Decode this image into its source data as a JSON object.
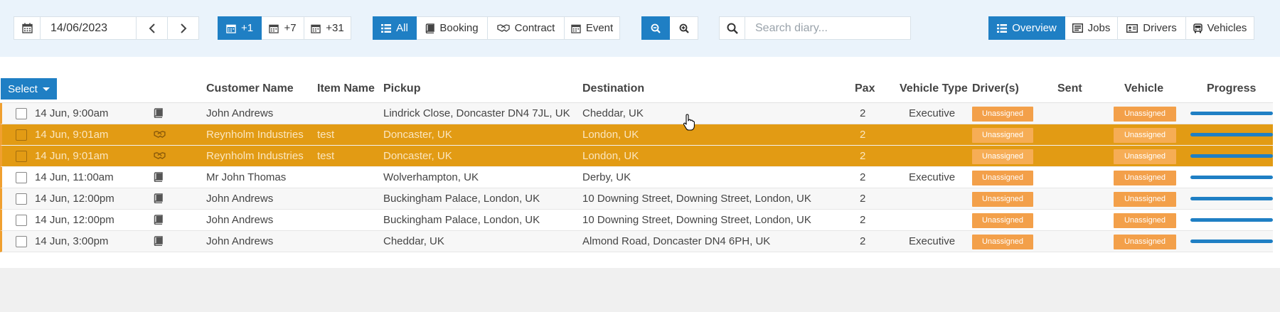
{
  "toolbar": {
    "date_value": "14/06/2023",
    "range_buttons": [
      "+1",
      "+7",
      "+31"
    ],
    "filter_buttons": [
      "All",
      "Booking",
      "Contract",
      "Event"
    ],
    "search_placeholder": "Search diary...",
    "view_buttons": [
      "Overview",
      "Jobs",
      "Drivers",
      "Vehicles"
    ]
  },
  "select_label": "Select",
  "columns": {
    "customer": "Customer Name",
    "item": "Item Name",
    "pickup": "Pickup",
    "destination": "Destination",
    "pax": "Pax",
    "vehicle_type": "Vehicle Type",
    "drivers": "Driver(s)",
    "sent": "Sent",
    "vehicle": "Vehicle",
    "progress": "Progress"
  },
  "rows": [
    {
      "time": "14 Jun, 9:00am",
      "type_icon": "book-icon",
      "customer": "John Andrews",
      "item": "",
      "pickup": "Lindrick Close, Doncaster DN4 7JL, UK",
      "destination": "Cheddar, UK",
      "pax": "2",
      "vehicle_type": "Executive",
      "driver": "Unassigned",
      "vehicle": "Unassigned",
      "highlight": false,
      "progress": 1
    },
    {
      "time": "14 Jun, 9:01am",
      "type_icon": "handshake-icon",
      "customer": "Reynholm Industries",
      "item": "test",
      "pickup": "Doncaster, UK",
      "destination": "London, UK",
      "pax": "2",
      "vehicle_type": "",
      "driver": "Unassigned",
      "vehicle": "Unassigned",
      "highlight": true,
      "progress": 1
    },
    {
      "time": "14 Jun, 9:01am",
      "type_icon": "handshake-icon",
      "customer": "Reynholm Industries",
      "item": "test",
      "pickup": "Doncaster, UK",
      "destination": "London, UK",
      "pax": "2",
      "vehicle_type": "",
      "driver": "Unassigned",
      "vehicle": "Unassigned",
      "highlight": true,
      "progress": 1
    },
    {
      "time": "14 Jun, 11:00am",
      "type_icon": "book-icon",
      "customer": "Mr John Thomas",
      "item": "",
      "pickup": "Wolverhampton, UK",
      "destination": "Derby, UK",
      "pax": "2",
      "vehicle_type": "Executive",
      "driver": "Unassigned",
      "vehicle": "Unassigned",
      "highlight": false,
      "progress": 1
    },
    {
      "time": "14 Jun, 12:00pm",
      "type_icon": "book-icon",
      "customer": "John Andrews",
      "item": "",
      "pickup": "Buckingham Palace, London, UK",
      "destination": "10 Downing Street, Downing Street, London, UK",
      "pax": "2",
      "vehicle_type": "",
      "driver": "Unassigned",
      "vehicle": "Unassigned",
      "highlight": false,
      "progress": 1
    },
    {
      "time": "14 Jun, 12:00pm",
      "type_icon": "book-icon",
      "customer": "John Andrews",
      "item": "",
      "pickup": "Buckingham Palace, London, UK",
      "destination": "10 Downing Street, Downing Street, London, UK",
      "pax": "2",
      "vehicle_type": "",
      "driver": "Unassigned",
      "vehicle": "Unassigned",
      "highlight": false,
      "progress": 1
    },
    {
      "time": "14 Jun, 3:00pm",
      "type_icon": "book-icon",
      "customer": "John Andrews",
      "item": "",
      "pickup": "Cheddar, UK",
      "destination": "Almond Road, Doncaster DN4 6PH, UK",
      "pax": "2",
      "vehicle_type": "Executive",
      "driver": "Unassigned",
      "vehicle": "Unassigned",
      "highlight": false,
      "progress": 1
    }
  ],
  "colors": {
    "accent": "#1f7fc4",
    "highlight_row": "#e29b14",
    "badge": "#f3a04a",
    "toolbar_bg": "#eaf3fb"
  }
}
